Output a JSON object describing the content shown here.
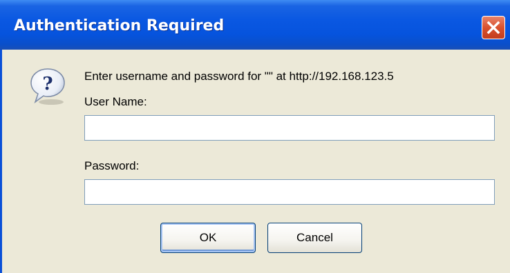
{
  "window": {
    "title": "Authentication Required",
    "close_icon": "close-icon",
    "colors": {
      "titlebar": "#0653dd",
      "dialog_bg": "#ece9d8",
      "close_button": "#d9512e"
    }
  },
  "dialog": {
    "icon": "question-icon",
    "message": "Enter username and password for \"\" at http://192.168.123.5",
    "username_label": "User Name:",
    "username_value": "",
    "password_label": "Password:",
    "password_value": "",
    "ok_label": "OK",
    "cancel_label": "Cancel"
  }
}
